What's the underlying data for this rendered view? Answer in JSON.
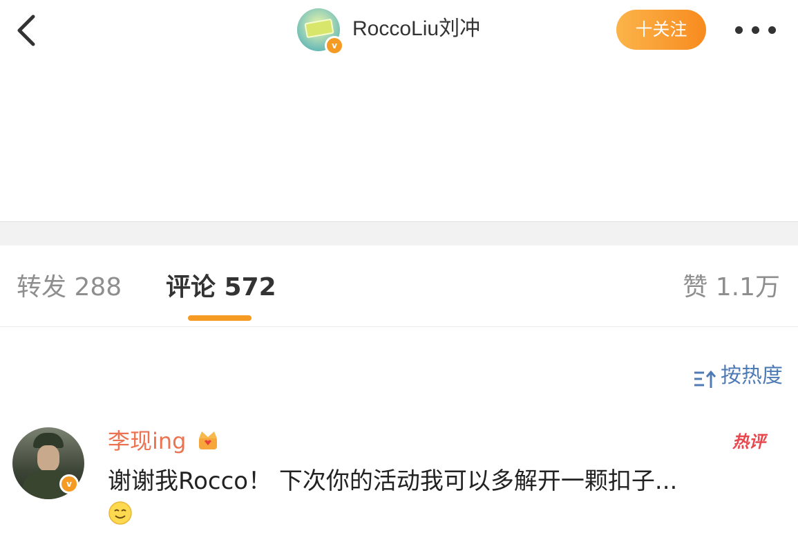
{
  "header": {
    "username": "RoccoLiu刘冲",
    "verify_mark": "v",
    "follow_label": "十关注",
    "back_icon": "chevron-left-icon",
    "more_icon": "ellipsis-icon"
  },
  "tabs": {
    "repost": "转发 288",
    "comments": "评论 572",
    "likes": "赞 1.1万",
    "active": "comments"
  },
  "sort": {
    "label": "按热度",
    "icon": "sort-icon"
  },
  "comment": {
    "author": "李现ing",
    "verify_mark": "v",
    "hot_label": "热评",
    "text": "谢谢我Rocco！ 下次你的活动我可以多解开一颗扣子...",
    "crown_icon": "crown-icon",
    "emoji_icon": "smile-emoji-icon"
  },
  "colors": {
    "accent": "#f59a23",
    "link": "#4f7bb5",
    "author_name": "#eb7350",
    "hot_badge": "#e8474e"
  }
}
